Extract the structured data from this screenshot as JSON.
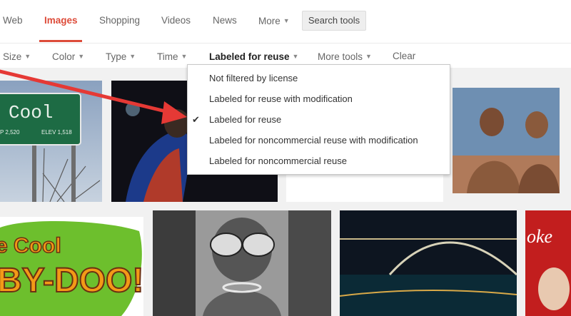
{
  "tabs": [
    {
      "label": "Web"
    },
    {
      "label": "Images"
    },
    {
      "label": "Shopping"
    },
    {
      "label": "Videos"
    },
    {
      "label": "News"
    },
    {
      "label": "More"
    }
  ],
  "search_tools": {
    "label": "Search tools"
  },
  "tools": [
    {
      "label": "Size"
    },
    {
      "label": "Color"
    },
    {
      "label": "Type"
    },
    {
      "label": "Time"
    },
    {
      "label": "Labeled for reuse"
    },
    {
      "label": "More tools"
    },
    {
      "label": "Clear"
    }
  ],
  "license_menu": {
    "items": [
      {
        "label": "Not filtered by license"
      },
      {
        "label": "Labeled for reuse with modification"
      },
      {
        "label": "Labeled for reuse",
        "selected": true
      },
      {
        "label": "Labeled for noncommercial reuse with modification"
      },
      {
        "label": "Labeled for noncommercial reuse"
      }
    ],
    "check_glyph": "✔"
  },
  "images": {
    "cool_sign": {
      "text": "Cool",
      "left_num": "P 2,520",
      "elev": "ELEV 1,518"
    },
    "cartoon": {
      "text_top": "e Cool",
      "text_bottom": "BY-DOO!"
    },
    "partial_right": {
      "text": "oke"
    }
  },
  "colors": {
    "accent": "#dd4b39",
    "arrow": "#e53935"
  }
}
